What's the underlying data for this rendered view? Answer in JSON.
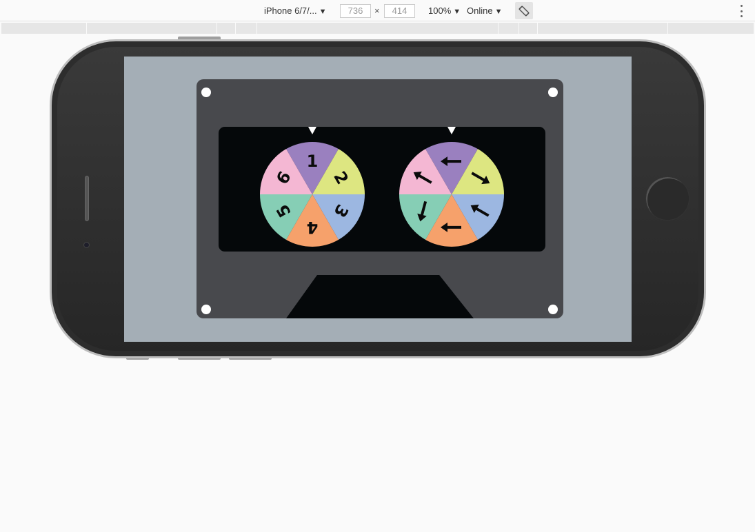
{
  "devtools": {
    "device": "iPhone 6/7/...",
    "width": "736",
    "height": "414",
    "zoom": "100%",
    "network": "Online",
    "icons": {
      "device_arrow": "dropdown-arrow",
      "zoom_arrow": "dropdown-arrow",
      "network_arrow": "dropdown-arrow",
      "rotate": "rotate-icon",
      "menu": "kebab-menu-icon"
    }
  },
  "app": {
    "colors": {
      "screen_bg": "#a4aeb6",
      "cassette": "#48494d",
      "window": "#05080a",
      "purple": "#9a80bf",
      "yellow": "#dde681",
      "blue": "#9cb7e1",
      "orange": "#f6a16b",
      "teal": "#86ceb5",
      "pink": "#f4b7d3"
    },
    "dice_wheel": {
      "pointer": "pointer-triangle",
      "segments": [
        {
          "label": "1",
          "color": "#9a80bf"
        },
        {
          "label": "2",
          "color": "#dde681"
        },
        {
          "label": "3",
          "color": "#9cb7e1"
        },
        {
          "label": "4",
          "color": "#f6a16b"
        },
        {
          "label": "5",
          "color": "#86ceb5"
        },
        {
          "label": "6",
          "color": "#f4b7d3"
        }
      ]
    },
    "direction_wheel": {
      "pointer": "pointer-triangle",
      "segments": [
        {
          "icon": "arrow-left",
          "color": "#9a80bf"
        },
        {
          "icon": "arrow-down-right",
          "color": "#dde681"
        },
        {
          "icon": "arrow-up-left",
          "color": "#9cb7e1"
        },
        {
          "icon": "arrow-left",
          "color": "#f6a16b"
        },
        {
          "icon": "arrow-down-left",
          "color": "#86ceb5"
        },
        {
          "icon": "arrow-up-left",
          "color": "#f4b7d3"
        }
      ]
    }
  }
}
